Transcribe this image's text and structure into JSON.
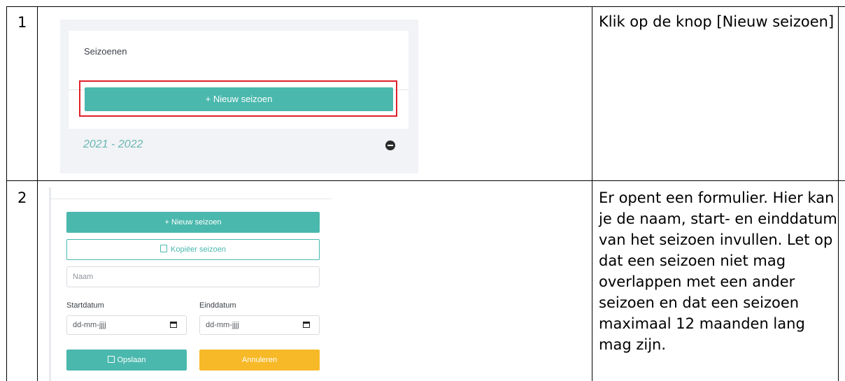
{
  "rows": [
    {
      "number": "1",
      "description": "Klik op de knop [Nieuw seizoen]",
      "screenshot": {
        "card_title": "Seizoenen",
        "new_season_button": "+ Nieuw seizoen",
        "season_item": "2021 - 2022",
        "highlight_color": "#e0202a"
      }
    },
    {
      "number": "2",
      "description": "Er opent een formulier. Hier kan je de naam, start- en einddatum van het seizoen invullen. Let op dat een seizoen niet mag overlappen met een ander seizoen en dat een seizoen maximaal 12 maanden lang mag zijn.",
      "screenshot": {
        "new_season_button": "+ Nieuw seizoen",
        "copy_season_button": "Kopiëer seizoen",
        "name_placeholder": "Naam",
        "start_label": "Startdatum",
        "end_label": "Einddatum",
        "date_placeholder": "dd-mm-jjjj",
        "save_button": "Opslaan",
        "cancel_button": "Annuleren"
      }
    }
  ],
  "colors": {
    "teal": "#4ab8ad",
    "yellow": "#f7b928",
    "season_text": "#69b7b3"
  }
}
